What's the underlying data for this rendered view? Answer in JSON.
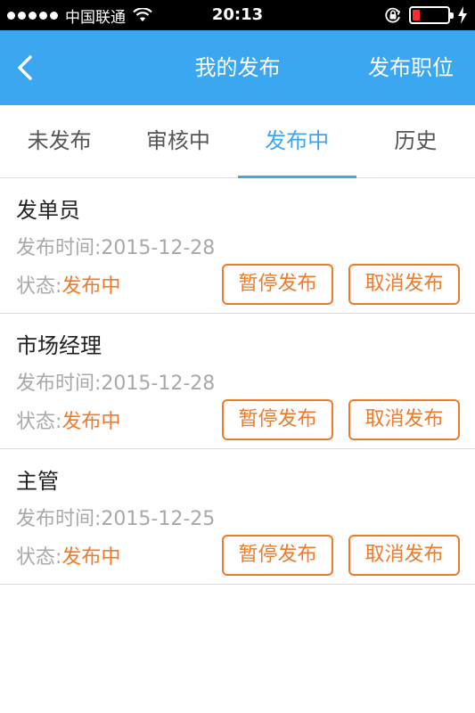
{
  "status_bar": {
    "carrier": "中国联通",
    "time": "20:13",
    "battery_percent": 20,
    "battery_color": "#ff2b2b",
    "icons": [
      "signal-dots-icon",
      "wifi-icon",
      "rotation-lock-icon",
      "battery-icon",
      "charging-bolt-icon"
    ]
  },
  "navbar": {
    "back_icon": "chevron-left-icon",
    "title": "我的发布",
    "action_label": "发布职位",
    "background": "#3aa7f0"
  },
  "tabs": [
    {
      "label": "未发布",
      "active": false
    },
    {
      "label": "审核中",
      "active": false
    },
    {
      "label": "发布中",
      "active": true
    },
    {
      "label": "历史",
      "active": false
    }
  ],
  "accent_color": "#f07a2a",
  "jobs": [
    {
      "title": "发单员",
      "time_label": "发布时间:",
      "time_value": "2015-12-28",
      "status_label": "状态:",
      "status_value": "发布中",
      "pause_label": "暂停发布",
      "cancel_label": "取消发布"
    },
    {
      "title": "市场经理",
      "time_label": "发布时间:",
      "time_value": "2015-12-28",
      "status_label": "状态:",
      "status_value": "发布中",
      "pause_label": "暂停发布",
      "cancel_label": "取消发布"
    },
    {
      "title": "主管",
      "time_label": "发布时间:",
      "time_value": "2015-12-25",
      "status_label": "状态:",
      "status_value": "发布中",
      "pause_label": "暂停发布",
      "cancel_label": "取消发布"
    }
  ]
}
